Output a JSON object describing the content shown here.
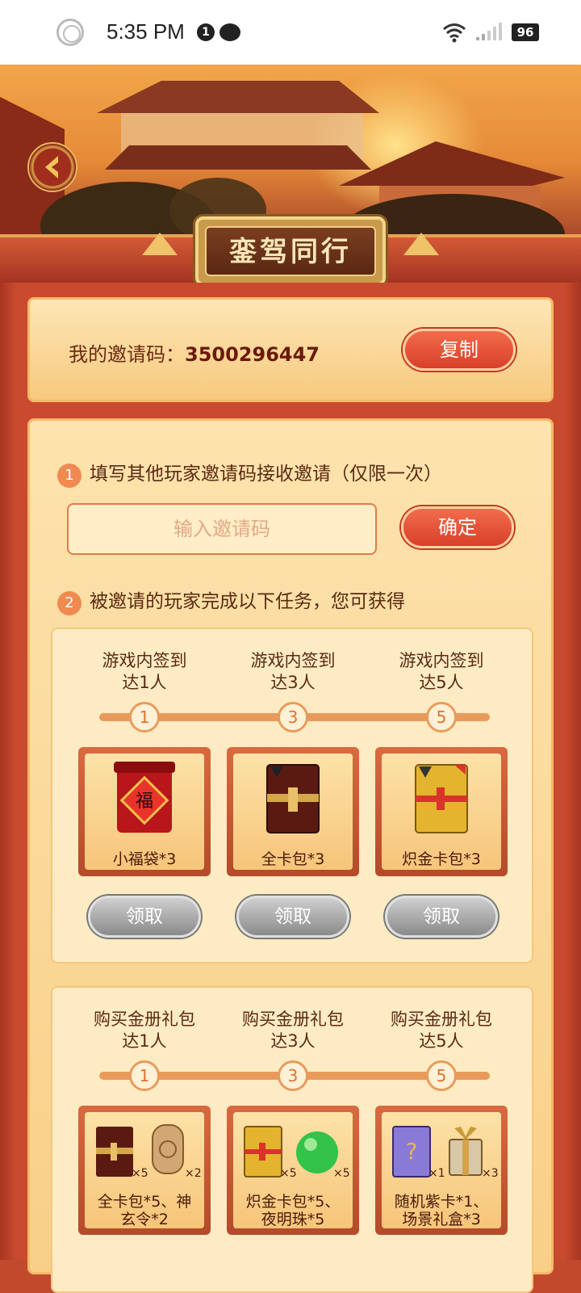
{
  "status_bar": {
    "time": "5:35 PM",
    "notification_count": "1",
    "battery": "96"
  },
  "header": {
    "title": "銮驾同行"
  },
  "invite": {
    "label": "我的邀请码：",
    "code": "3500296447",
    "copy_label": "复制"
  },
  "step1": {
    "num": "1",
    "text": "填写其他玩家邀请码接收邀请（仅限一次）",
    "input_placeholder": "输入邀请码",
    "confirm_label": "确定"
  },
  "step2": {
    "num": "2",
    "text": "被邀请的玩家完成以下任务，您可获得"
  },
  "tasks_signin": {
    "columns": [
      {
        "title": "游戏内签到\n达1人",
        "node": "1",
        "reward": "小福袋*3",
        "claim": "领取"
      },
      {
        "title": "游戏内签到\n达3人",
        "node": "3",
        "reward": "全卡包*3",
        "claim": "领取"
      },
      {
        "title": "游戏内签到\n达5人",
        "node": "5",
        "reward": "炽金卡包*3",
        "claim": "领取"
      }
    ]
  },
  "tasks_purchase": {
    "columns": [
      {
        "title": "购买金册礼包\n达1人",
        "node": "1",
        "reward": "全卡包*5、神\n玄令*2",
        "m1": "×5",
        "m2": "×2"
      },
      {
        "title": "购买金册礼包\n达3人",
        "node": "3",
        "reward": "炽金卡包*5、\n夜明珠*5",
        "m1": "×5",
        "m2": "×5"
      },
      {
        "title": "购买金册礼包\n达5人",
        "node": "5",
        "reward": "随机紫卡*1、\n场景礼盒*3",
        "m1": "×1",
        "m2": "×3"
      }
    ]
  },
  "colors": {
    "accent": "#d8402a",
    "panel": "#fde3ad",
    "disabled": "#9a9a9a"
  }
}
